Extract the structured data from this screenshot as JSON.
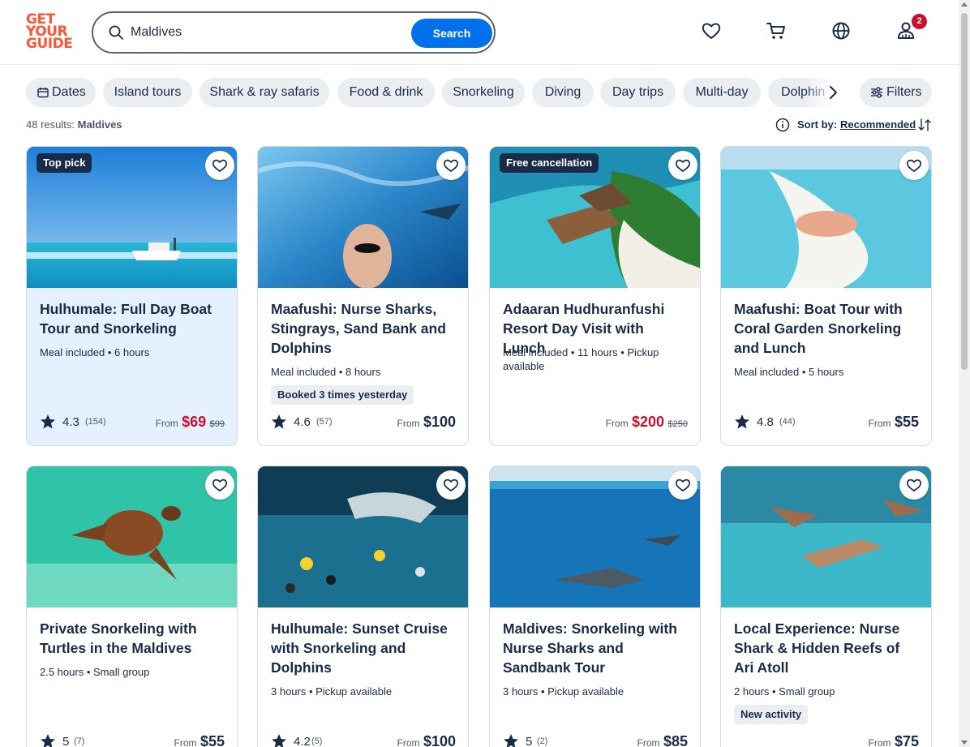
{
  "brand": {
    "logo_lines": [
      "GET",
      "YOUR",
      "GUIDE"
    ],
    "accent": "#ff5533",
    "primary": "#0071eb",
    "sale": "#c8102e"
  },
  "search": {
    "value": "Maldives",
    "button": "Search",
    "icon": "search-icon"
  },
  "header_icons": [
    "heart-icon",
    "cart-icon",
    "globe-icon",
    "profile-icon"
  ],
  "notification_count": "2",
  "chips": [
    "Dates",
    "Island tours",
    "Shark & ray safaris",
    "Food & drink",
    "Snorkeling",
    "Diving",
    "Day trips",
    "Multi-day",
    "Dolphin"
  ],
  "filters_label": "Filters",
  "results": {
    "count": "48 results:",
    "query": "Maldives"
  },
  "sort": {
    "label": "Sort by:",
    "value": "Recommended"
  },
  "cards": [
    {
      "tag": "Top pick",
      "title": "Hulhumale: Full Day Boat Tour and Snorkeling",
      "meta": "Meal included • 6 hours",
      "pill": "",
      "rating": "4.3",
      "reviews": "(154)",
      "from": "From",
      "price": "$69",
      "old_price": "$99"
    },
    {
      "tag": "",
      "title": "Maafushi: Nurse Sharks, Stingrays, Sand Bank and Dolphins",
      "meta": "Meal included • 8 hours",
      "pill": "Booked 3 times yesterday",
      "rating": "4.6",
      "reviews": "(57)",
      "from": "From",
      "price": "$100",
      "old_price": ""
    },
    {
      "tag": "Free cancellation",
      "title": "Adaaran Hudhuranfushi Resort Day Visit with Lunch",
      "meta": "Meal included • 11 hours • Pickup available",
      "pill": "",
      "rating": "",
      "reviews": "",
      "from": "From",
      "price": "$200",
      "old_price": "$250"
    },
    {
      "tag": "",
      "title": "Maafushi: Boat Tour with Coral Garden Snorkeling and Lunch",
      "meta": "Meal included • 5 hours",
      "pill": "",
      "rating": "4.8",
      "reviews": "(44)",
      "from": "From",
      "price": "$55",
      "old_price": ""
    },
    {
      "tag": "",
      "title": "Private Snorkeling with Turtles in the Maldives",
      "meta": "2.5 hours • Small group",
      "pill": "",
      "rating": "5",
      "reviews": "(7)",
      "from": "From",
      "price": "$55",
      "old_price": ""
    },
    {
      "tag": "",
      "title": "Hulhumale: Sunset Cruise with Snorkeling and Dolphins",
      "meta": "3 hours • Pickup available",
      "pill": "",
      "rating": "4.2",
      "reviews": "(5)",
      "from": "From",
      "price": "$100",
      "old_price": ""
    },
    {
      "tag": "",
      "title": "Maldives: Snorkeling with Nurse Sharks and Sandbank Tour",
      "meta": "3 hours • Pickup available",
      "pill": "",
      "rating": "5",
      "reviews": "(2)",
      "from": "From",
      "price": "$85",
      "old_price": ""
    },
    {
      "tag": "",
      "title": "Local Experience: Nurse Shark & Hidden Reefs of Ari Atoll",
      "meta": "2 hours • Small group",
      "pill": "New activity",
      "rating": "",
      "reviews": "",
      "from": "From",
      "price": "$75",
      "old_price": ""
    }
  ]
}
